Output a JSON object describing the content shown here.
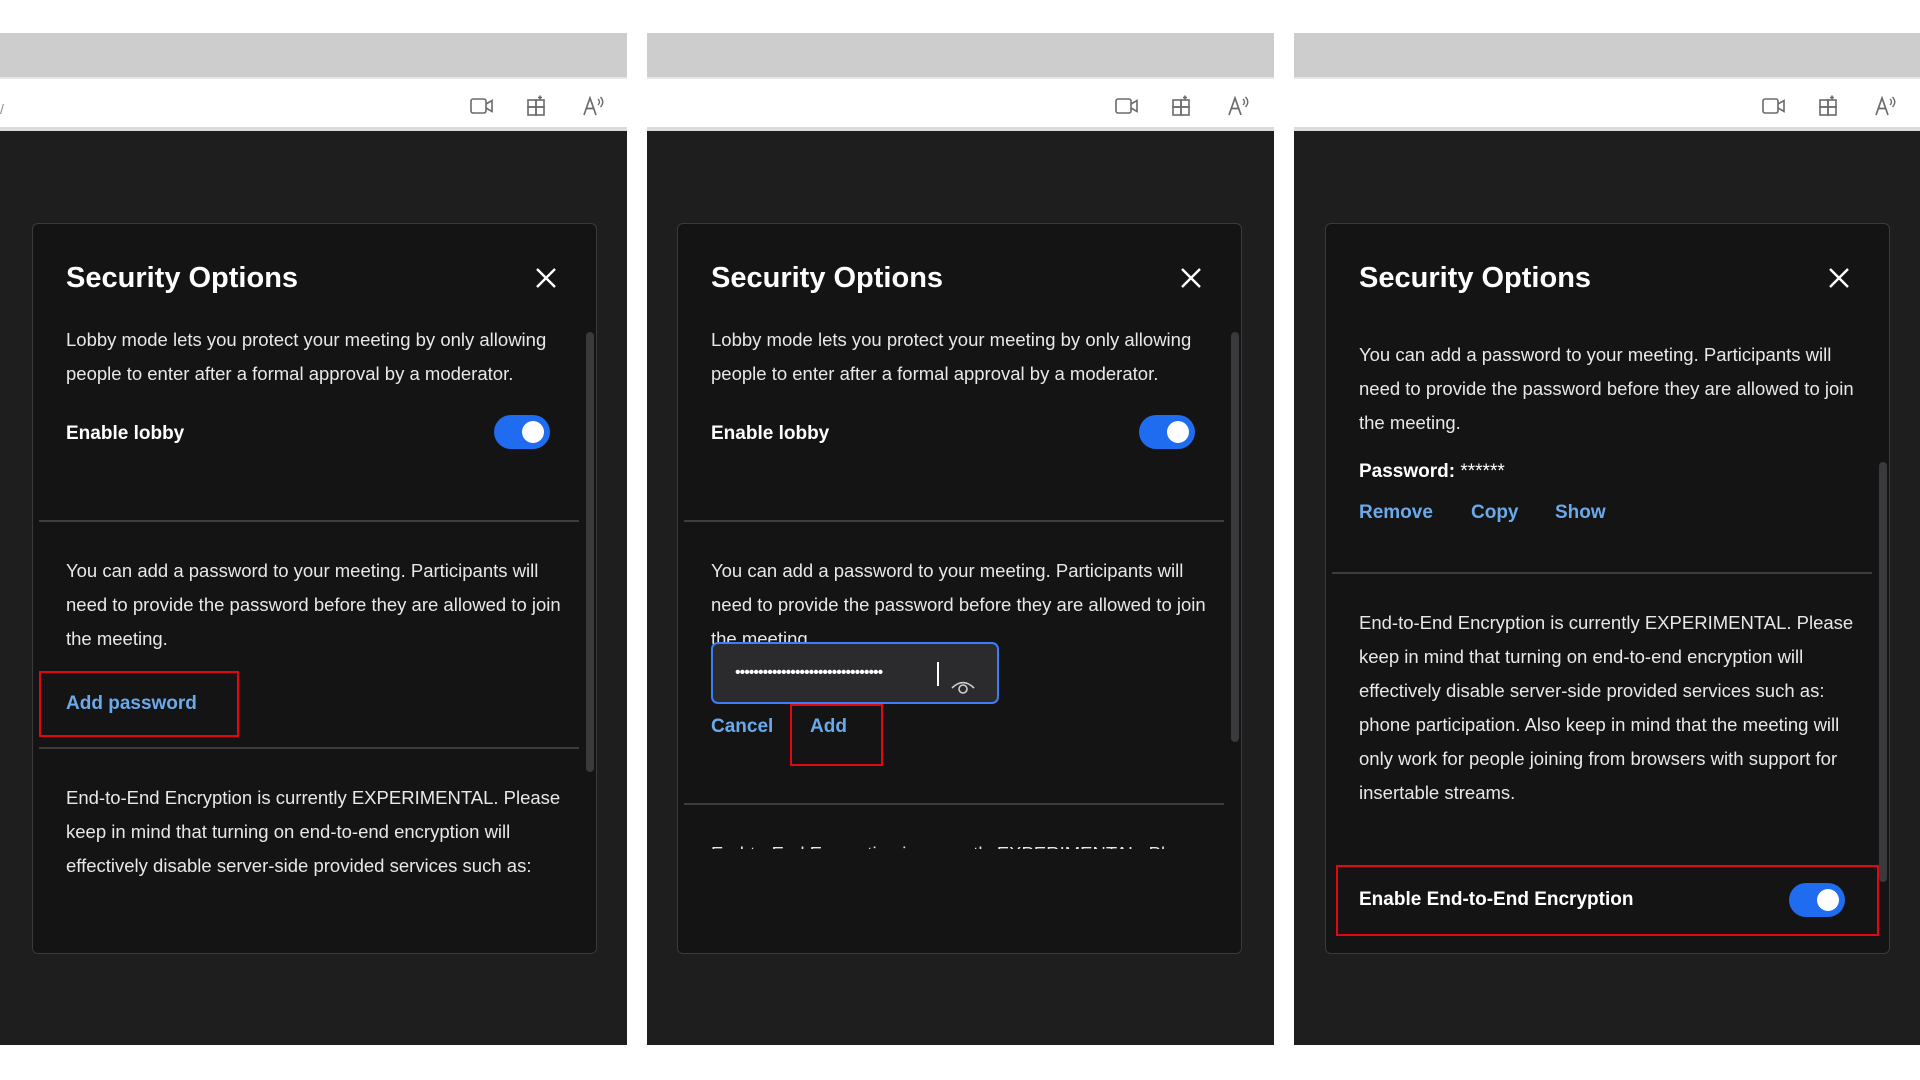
{
  "dialog": {
    "title": "Security Options"
  },
  "lobby": {
    "description": "Lobby mode lets you protect your meeting by only allowing people to enter after a formal approval by a moderator.",
    "label": "Enable lobby",
    "enabled": true
  },
  "password": {
    "description": "You can add a password to your meeting. Participants will need to provide the password before they are allowed to join the meeting.",
    "add_label": "Add password",
    "input_value": "••••••••••••••••••••••••••••••••",
    "cancel_label": "Cancel",
    "add_button_label": "Add",
    "password_label": "Password:",
    "password_masked": "******",
    "remove_label": "Remove",
    "copy_label": "Copy",
    "show_label": "Show"
  },
  "e2ee": {
    "description": "End-to-End Encryption is currently EXPERIMENTAL. Please keep in mind that turning on end-to-end encryption will effectively disable server-side provided services such as: phone participation. Also keep in mind that the meeting will only work for people joining from browsers with support for insertable streams.",
    "label": "Enable End-to-End Encryption",
    "enabled": true
  },
  "toolbar": {
    "icons": [
      "video-icon",
      "extensions-icon",
      "read-aloud-icon"
    ]
  },
  "colors": {
    "accent": "#1f6cf0",
    "link": "#6aa9ea",
    "highlight": "#e30613",
    "background": "#1e1e1f",
    "dialog": "#141415"
  }
}
